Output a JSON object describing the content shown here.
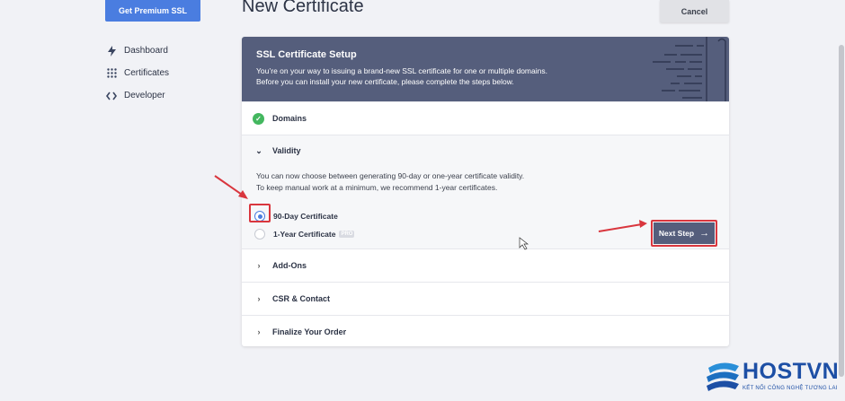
{
  "sidebar": {
    "premium_button": "Get Premium SSL",
    "items": [
      {
        "label": "Dashboard",
        "icon": "bolt-icon"
      },
      {
        "label": "Certificates",
        "icon": "grid-dots-icon"
      },
      {
        "label": "Developer",
        "icon": "code-icon"
      }
    ]
  },
  "header": {
    "title": "New Certificate",
    "cancel_label": "Cancel"
  },
  "setup": {
    "title": "SSL Certificate Setup",
    "intro_line1": "You’re on your way to issuing a brand-new SSL certificate for one or multiple domains.",
    "intro_line2": "Before you can install your new certificate, please complete the steps below.",
    "steps": {
      "domains": "Domains",
      "validity": "Validity",
      "addons": "Add-Ons",
      "csr": "CSR & Contact",
      "finalize": "Finalize Your Order"
    },
    "validity_desc_line1": "You can now choose between generating 90-day or one-year certificate validity.",
    "validity_desc_line2": "To keep manual work at a minimum, we recommend 1-year certificates.",
    "options": [
      {
        "label": "90-Day Certificate",
        "selected": true
      },
      {
        "label": "1-Year Certificate",
        "selected": false,
        "badge": "PRO"
      }
    ],
    "next_label": "Next Step"
  },
  "watermark": {
    "name": "HOSTVN",
    "tagline": "KẾT NỐI CÔNG NGHỆ TƯƠNG LAI"
  },
  "colors": {
    "accent": "#4a7de0",
    "header_bg": "#555e7c",
    "success": "#43b75f",
    "annotation_red": "#d9363e"
  }
}
